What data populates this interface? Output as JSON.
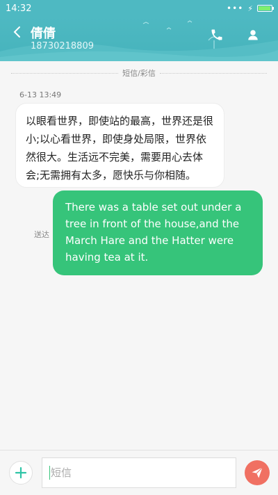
{
  "status_bar": {
    "time": "14:32",
    "signal_dots": "•••",
    "battery_level": 0.95
  },
  "header": {
    "contact_name": "倩倩",
    "contact_number": "18730218809",
    "back_icon": "chevron-left-icon",
    "call_icon": "phone-icon",
    "profile_icon": "person-icon"
  },
  "conversation": {
    "type_label": "短信/彩信",
    "timestamp": "6-13 13:49",
    "incoming_message": "以眼看世界，即使站的最高，世界还是很小;以心看世界，即使身处局限，世界依然很大。生活远不完美，需要用心去体会;无需拥有太多，愿快乐与你相随。",
    "outgoing_message": "There was a table set out under a tree in front of the house,and the March Hare and the Hatter were having tea at it.",
    "sent_status": "送达"
  },
  "composer": {
    "placeholder": "短信",
    "add_icon": "plus-icon",
    "send_icon": "send-icon"
  },
  "colors": {
    "header_teal": "#4eb9c2",
    "outgoing_bubble": "#36c47a",
    "send_button": "#f07062",
    "add_button_plus": "#2ec4a6"
  }
}
